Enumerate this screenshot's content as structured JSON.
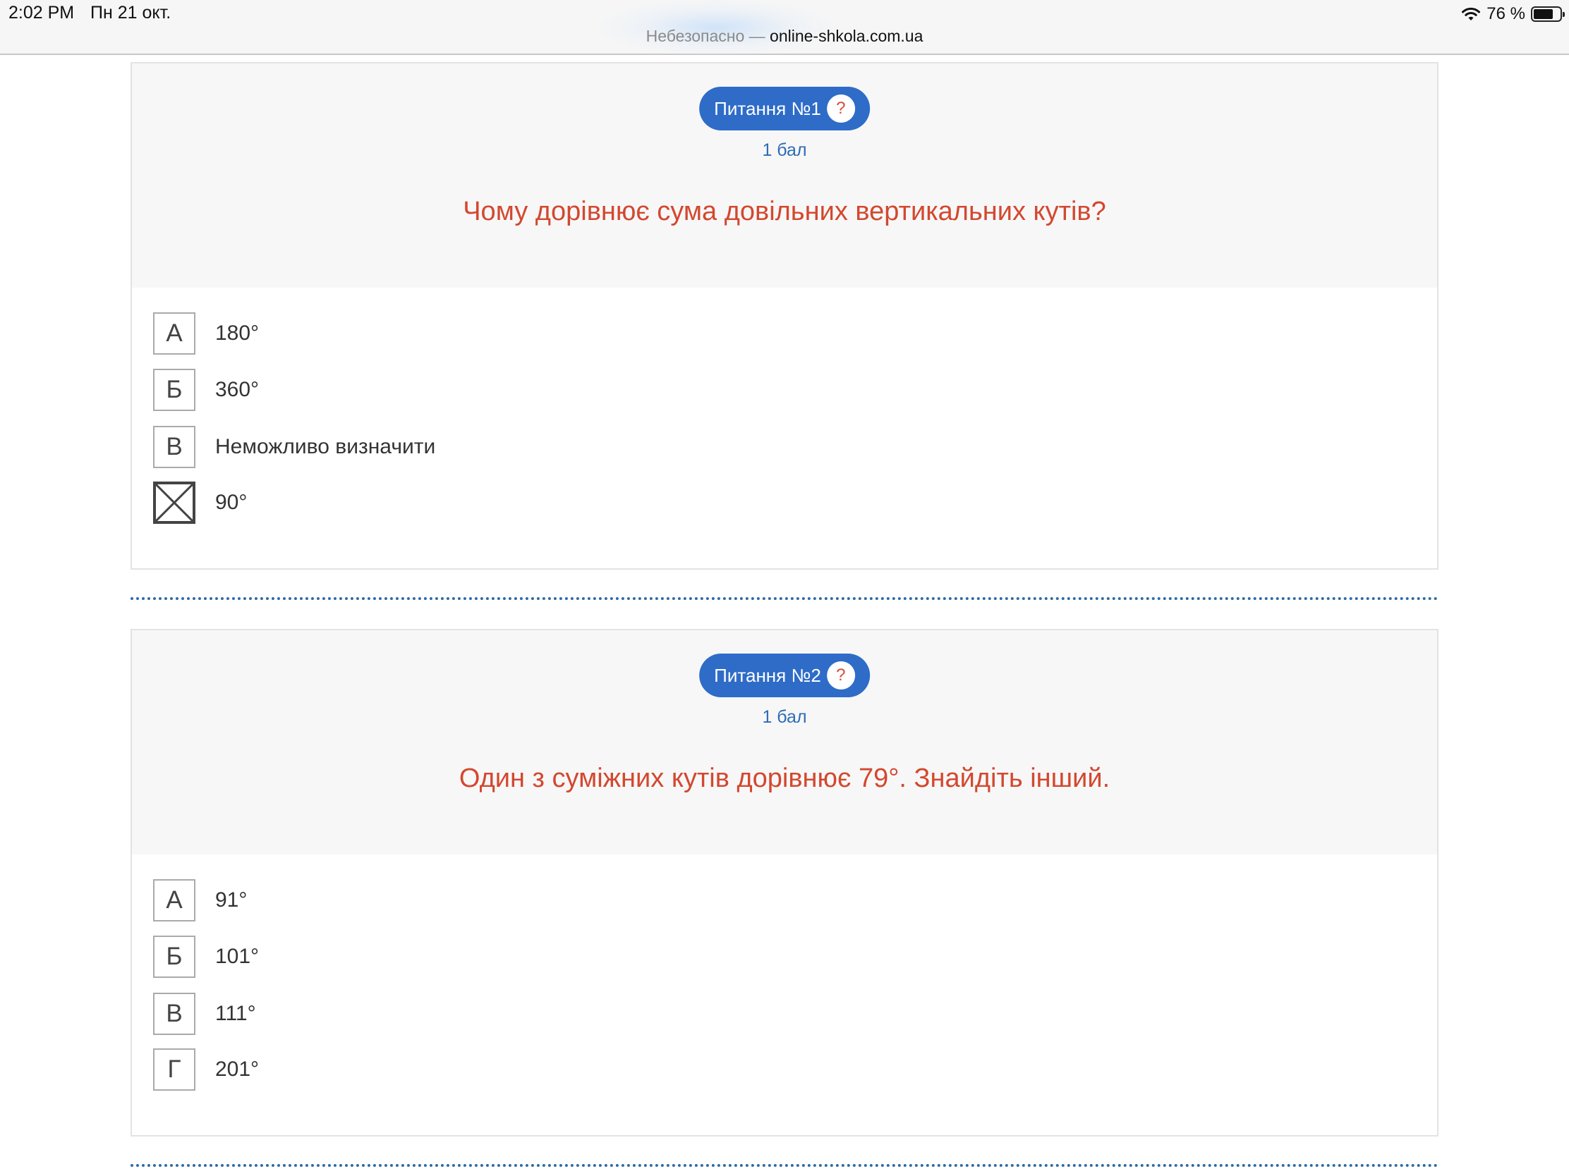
{
  "status_bar": {
    "time": "2:02 PM",
    "date": "Пн 21 окт.",
    "battery": "76 %",
    "battery_level": 0.76
  },
  "address_bar": {
    "insecure_label": "Небезопасно",
    "separator": "—",
    "domain": "online-shkola.com.ua"
  },
  "questions": [
    {
      "badge": "Питання №1",
      "help": "?",
      "points": "1 бал",
      "text": "Чому дорівнює сума довільних вертикальних кутів?",
      "options": [
        {
          "letter": "А",
          "text": "180°",
          "selected": false
        },
        {
          "letter": "Б",
          "text": "360°",
          "selected": false
        },
        {
          "letter": "В",
          "text": "Неможливо визначити",
          "selected": false
        },
        {
          "letter": "",
          "text": "90°",
          "selected": true
        }
      ]
    },
    {
      "badge": "Питання №2",
      "help": "?",
      "points": "1 бал",
      "text": "Один з суміжних кутів дорівнює 79°. Знайдіть інший.",
      "options": [
        {
          "letter": "А",
          "text": "91°",
          "selected": false
        },
        {
          "letter": "Б",
          "text": "101°",
          "selected": false
        },
        {
          "letter": "В",
          "text": "111°",
          "selected": false
        },
        {
          "letter": "Г",
          "text": "201°",
          "selected": false
        }
      ]
    }
  ],
  "colors": {
    "accent_blue": "#2e6cc8",
    "question_red": "#d3482f",
    "points_blue": "#2e6cb4",
    "divider_blue": "#2e6ca4"
  }
}
